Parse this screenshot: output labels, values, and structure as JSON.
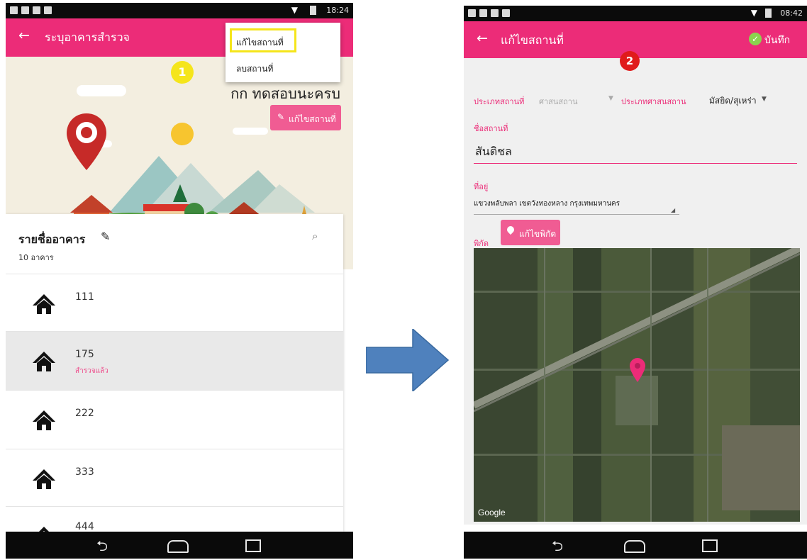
{
  "left_screen": {
    "status_time": "18:24",
    "appbar_title": "ระบุอาคารสำรวจ",
    "menu": {
      "items": [
        "แก้ไขสถานที่",
        "ลบสถานที่"
      ]
    },
    "step_badge": "1",
    "place_name": "กก ทดสอบนะครบ",
    "edit_place_button": "แก้ไขสถานที่",
    "building_list_title": "รายชื่ออาคาร",
    "building_count": "10 อาคาร",
    "buildings": [
      {
        "number": "111",
        "status": ""
      },
      {
        "number": "175",
        "status": "สำรวจแล้ว"
      },
      {
        "number": "222",
        "status": ""
      },
      {
        "number": "333",
        "status": ""
      },
      {
        "number": "444",
        "status": ""
      }
    ]
  },
  "right_screen": {
    "status_time": "08:42",
    "appbar_title": "แก้ไขสถานที่",
    "save_button": "บันทึก",
    "step_badge": "2",
    "place_type_label": "ประเภทสถานที่",
    "place_type_value": "ศาสนสถาน",
    "religious_type_label": "ประเภทศาสนสถาน",
    "religious_type_value": "มัสยิด/สุเหร่า",
    "place_name_label": "ชื่อสถานที่",
    "place_name_value": "สันติชล",
    "address_label": "ที่อยู่",
    "address_value": "แขวงพลับพลา เขตวังทองหลาง กรุงเทพมหานคร",
    "coords_label": "พิกัด",
    "edit_coords_button": "แก้ไขพิกัด",
    "map_attribution": "Google"
  },
  "colors": {
    "primary": "#ec2c78",
    "badge_yellow": "#f5e51b",
    "badge_red": "#e01b1b",
    "arrow": "#4f81bd"
  }
}
